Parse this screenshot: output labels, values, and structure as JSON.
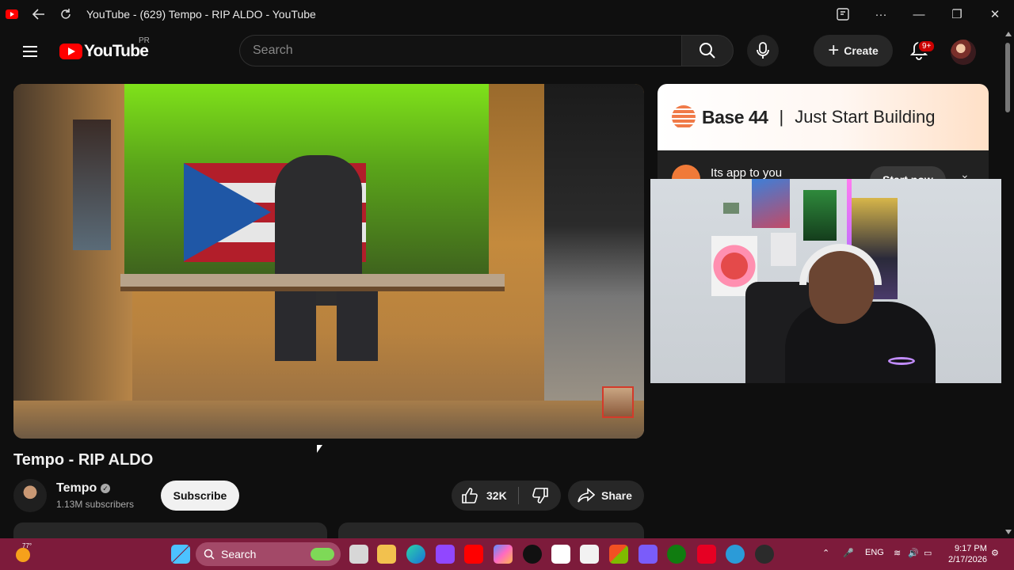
{
  "window": {
    "title": "YouTube - (629) Tempo - RIP ALDO - YouTube",
    "back_icon": "back-arrow-icon",
    "refresh_icon": "refresh-icon",
    "controls": [
      "app-icon",
      "more-icon",
      "minimize-icon",
      "restore-icon",
      "close-icon"
    ]
  },
  "masthead": {
    "logo_text": "YouTube",
    "country_code": "PR",
    "search_placeholder": "Search",
    "create_label": "Create",
    "notifications_badge": "9+"
  },
  "ad": {
    "brand": "Base 44",
    "separator": "|",
    "tagline": "Just Start Building",
    "app_text": "Its app to you",
    "cta_label": "Start now"
  },
  "video": {
    "title": "Tempo - RIP ALDO",
    "channel_name": "Tempo",
    "subscribers": "1.13M subscribers",
    "subscribe_label": "Subscribe",
    "likes": "32K",
    "share_label": "Share"
  },
  "taskbar": {
    "weather_temp": "77°",
    "search_label": "Search",
    "language": "ENG",
    "time": "9:17 PM",
    "date": "2/17/2026"
  },
  "colors": {
    "background": "#0f0f0f",
    "accent": "#ff0000",
    "taskbar": "#7d1b3b"
  }
}
